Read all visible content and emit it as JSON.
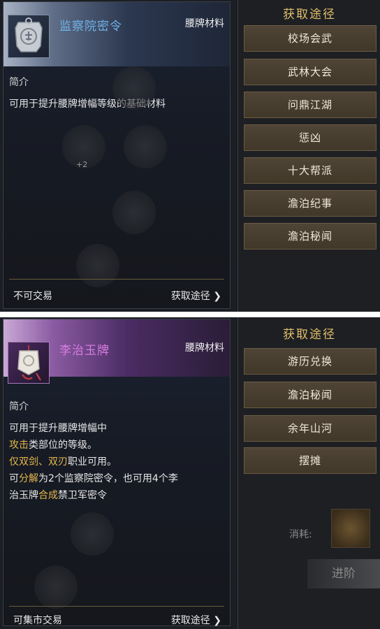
{
  "top": {
    "item": {
      "name": "监察院密令",
      "type": "腰牌材料",
      "icon": "token-seal-icon"
    },
    "section_title": "简介",
    "description": "可用于提升腰牌增幅等级的基础材料",
    "trade_status": "不可交易",
    "source_link": "获取途径 ❯",
    "sources_title": "获取途径",
    "sources": [
      "校场会武",
      "武林大会",
      "问鼎江湖",
      "惩凶",
      "十大帮派",
      "澹泊纪事",
      "澹泊秘闻"
    ],
    "ghost_plus": "+2"
  },
  "bottom": {
    "item": {
      "name": "李治玉牌",
      "type": "腰牌材料",
      "icon": "jade-tablet-icon"
    },
    "section_title": "简介",
    "desc_lines": {
      "l1": "可用于提升腰牌增幅中",
      "l2_hl": "攻击",
      "l2": "类部位的等级。",
      "l3_hl": "仅双剑、双刃",
      "l3": "职业可用。",
      "l4_a": "可",
      "l4_hl": "分解",
      "l4_b": "为2个监察院密令，也可用4个李",
      "l5_a": "治玉牌",
      "l5_hl": "合成",
      "l5_b": "禁卫军密令"
    },
    "trade_status": "可集市交易",
    "source_link": "获取途径 ❯",
    "sources_title": "获取途径",
    "sources": [
      "游历兑换",
      "澹泊秘闻",
      "余年山河",
      "摆摊"
    ],
    "consume_label": "消耗:",
    "advance_label": "进阶"
  },
  "colors": {
    "rarity_blue": "#6fb2e8",
    "rarity_purple": "#d87de0",
    "highlight": "#e5b84c",
    "source_title": "#e2bf6a"
  }
}
